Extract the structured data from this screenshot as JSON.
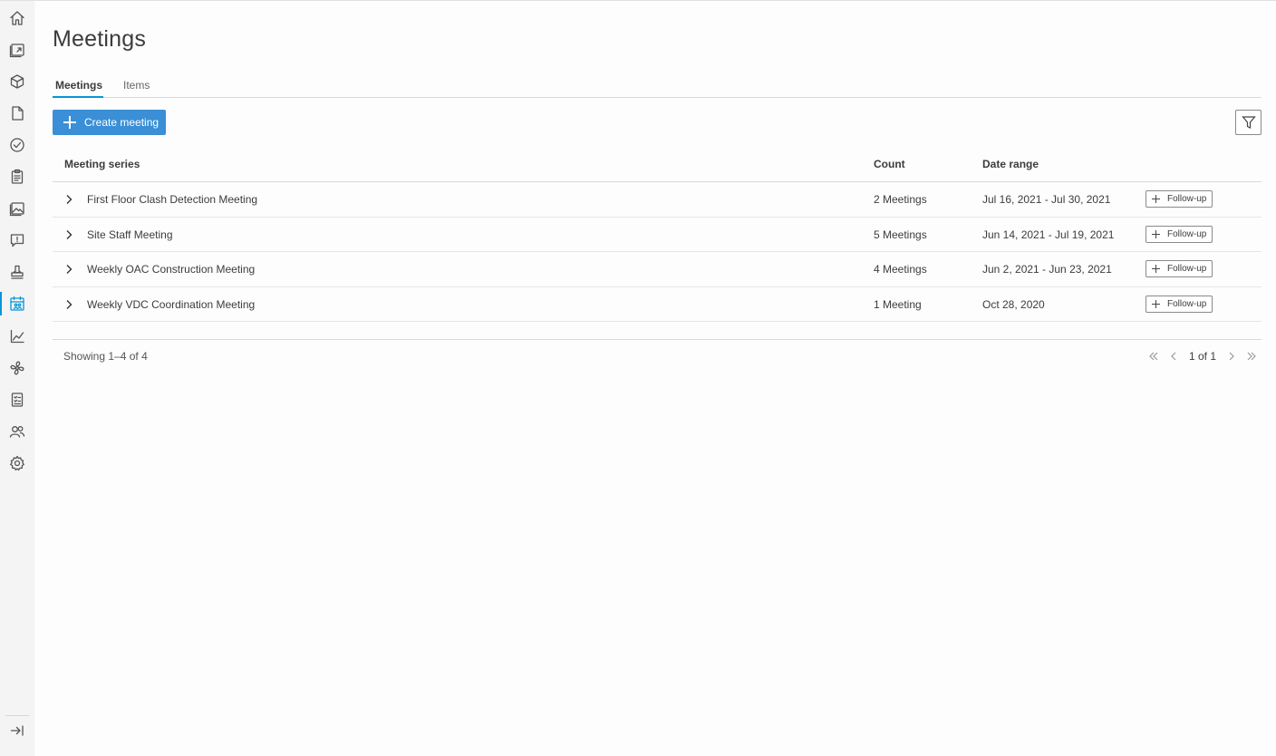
{
  "sidebar": {
    "items": [
      {
        "icon": "home-icon"
      },
      {
        "icon": "sheets-icon"
      },
      {
        "icon": "model-cube-icon"
      },
      {
        "icon": "document-icon"
      },
      {
        "icon": "check-circle-icon"
      },
      {
        "icon": "clipboard-icon"
      },
      {
        "icon": "photos-icon"
      },
      {
        "icon": "rfi-chat-icon"
      },
      {
        "icon": "stamp-icon"
      },
      {
        "icon": "meetings-calendar-icon",
        "active": true
      },
      {
        "icon": "insight-chart-icon"
      },
      {
        "icon": "fan-icon"
      },
      {
        "icon": "forms-icon"
      },
      {
        "icon": "members-icon"
      },
      {
        "icon": "settings-gear-icon"
      }
    ],
    "collapse_icon": "collapse-arrow-icon"
  },
  "page": {
    "title": "Meetings",
    "tabs": [
      {
        "label": "Meetings",
        "active": true
      },
      {
        "label": "Items",
        "active": false
      }
    ],
    "create_button": "Create meeting",
    "filter_icon": "filter-icon"
  },
  "table": {
    "headers": {
      "series": "Meeting series",
      "count": "Count",
      "date_range": "Date range"
    },
    "rows": [
      {
        "name": "First Floor Clash Detection Meeting",
        "count": "2 Meetings",
        "dates": "Jul 16, 2021 - Jul 30, 2021",
        "action": "Follow-up"
      },
      {
        "name": "Site Staff Meeting",
        "count": "5 Meetings",
        "dates": "Jun 14, 2021 - Jul 19, 2021",
        "action": "Follow-up"
      },
      {
        "name": "Weekly OAC Construction Meeting",
        "count": "4 Meetings",
        "dates": "Jun 2, 2021 - Jun 23, 2021",
        "action": "Follow-up"
      },
      {
        "name": "Weekly VDC Coordination Meeting",
        "count": "1 Meeting",
        "dates": "Oct 28, 2020",
        "action": "Follow-up"
      }
    ]
  },
  "footer": {
    "showing": "Showing 1–4 of 4",
    "page_info": "1 of 1"
  },
  "colors": {
    "accent": "#0696d7",
    "primary_button": "#3a8fd6"
  }
}
